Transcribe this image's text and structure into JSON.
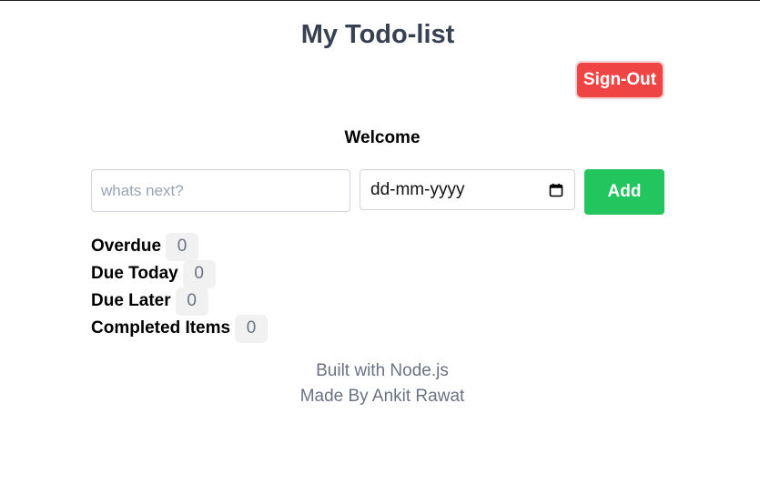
{
  "header": {
    "title": "My Todo-list",
    "signout_label": "Sign-Out"
  },
  "greeting": "Welcome",
  "form": {
    "todo_placeholder": "whats next?",
    "todo_value": "",
    "date_placeholder": "dd-mm-yyyy",
    "add_label": "Add"
  },
  "counts": [
    {
      "label": "Overdue",
      "value": "0"
    },
    {
      "label": "Due Today",
      "value": "0"
    },
    {
      "label": "Due Later",
      "value": "0"
    },
    {
      "label": "Completed Items",
      "value": "0"
    }
  ],
  "footer": {
    "line1": "Built with Node.js",
    "line2": "Made By Ankit Rawat"
  },
  "colors": {
    "title": "#374151",
    "signout": "#ef4444",
    "add": "#22c55e",
    "badge_bg": "#f1f1f1",
    "muted_text": "#6b7280"
  },
  "icons": {
    "date_picker": "calendar-icon"
  }
}
